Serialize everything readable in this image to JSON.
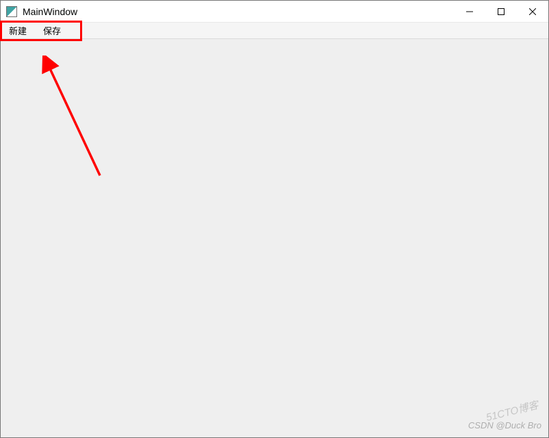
{
  "window": {
    "title": "MainWindow"
  },
  "menubar": {
    "items": [
      {
        "label": "新建"
      },
      {
        "label": "保存"
      }
    ]
  },
  "watermarks": {
    "top": "51CTO博客",
    "bottom": "CSDN @Duck Bro"
  },
  "annotation": {
    "highlight_color": "#ff0000"
  }
}
